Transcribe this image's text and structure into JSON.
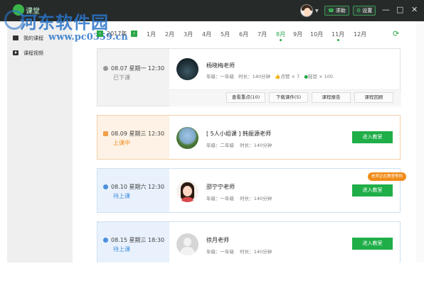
{
  "app": {
    "logo_text": "课堂"
  },
  "watermark": {
    "title": "河东软件园",
    "url": "www.pc0359.cn"
  },
  "topbar": {
    "help_label": "求助",
    "settings_label": "设置",
    "minimize": "—",
    "maximize": "□",
    "close": "✕"
  },
  "sidebar": {
    "items": [
      {
        "label": "我的课程"
      },
      {
        "label": "课程视频"
      }
    ]
  },
  "calendar": {
    "year": "2017年",
    "months": [
      "1月",
      "2月",
      "3月",
      "4月",
      "5月",
      "6月",
      "7月",
      "8月",
      "9月",
      "10月",
      "11月",
      "12月"
    ],
    "active_month": "8月"
  },
  "lessons": [
    {
      "time": "08.07 星期一 12:30",
      "status": "已下课",
      "teacher": "杨晓梅老师",
      "grade": "年级：一年级",
      "duration": "时长：140分钟",
      "likes": "点赞 × 7",
      "beans": "轻豆 × 100",
      "actions": [
        "查看重点(10)",
        "下载课件(5)",
        "课程报告",
        "课程回顾"
      ]
    },
    {
      "time": "08.09 星期三 12:30",
      "status": "上课中",
      "teacher": "[ 5人小组课 ] 韩振源老师",
      "grade": "年级：二年级",
      "duration": "时长：140分钟",
      "enter": "进入教室"
    },
    {
      "time": "08.10 星期六 12:30",
      "status": "待上课",
      "teacher": "邵宁宁老师",
      "grade": "年级：一年级",
      "duration": "时长：140分钟",
      "enter": "进入教室",
      "tip": "老师正在教室等你"
    },
    {
      "time": "08.15 星期三 18:30",
      "status": "待上课",
      "teacher": "徐月老师",
      "grade": "年级：一年级",
      "duration": "时长：140分钟",
      "enter": "进入教室"
    }
  ]
}
